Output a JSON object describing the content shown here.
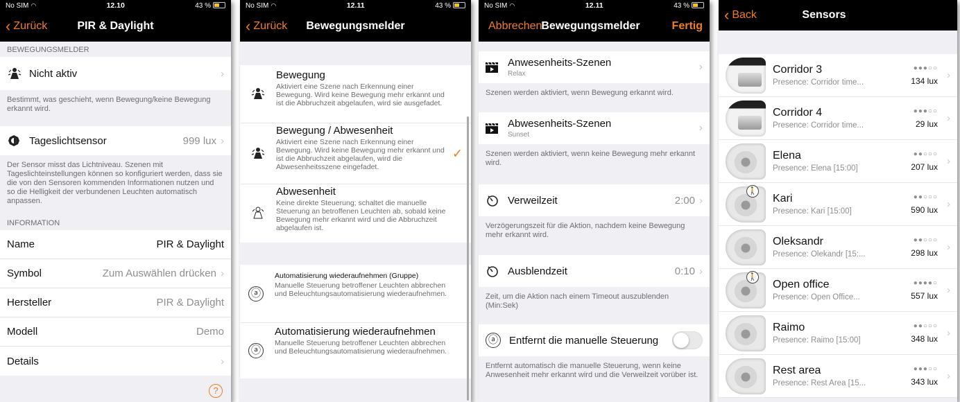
{
  "colors": {
    "accent": "#f07e1f",
    "navbar": "#000000",
    "background": "#efeff4"
  },
  "screen1": {
    "status": {
      "carrier": "No SIM",
      "time": "12.10",
      "battery": "43 %"
    },
    "nav": {
      "back": "Zurück",
      "title": "PIR & Daylight"
    },
    "section_motion": "BEWEGUNGSMELDER",
    "motion_cell": {
      "label": "Nicht aktiv",
      "icon": "people-icon"
    },
    "motion_footer": "Bestimmt, was geschieht, wenn Bewegung/keine Bewegung erkannt wird.",
    "daylight_cell": {
      "label": "Tageslichtsensor",
      "value": "999 lux",
      "icon": "brightness-icon"
    },
    "daylight_footer": "Der Sensor misst das Lichtniveau. Szenen mit Tageslichteinstellungen können so konfiguriert werden, dass sie die von den Sensoren kommenden Informationen nutzen und so die Helligkeit der verbundenen Leuchten automatisch anpassen.",
    "section_info": "INFORMATION",
    "info_rows": [
      {
        "label": "Name",
        "value": "PIR & Daylight"
      },
      {
        "label": "Symbol",
        "value": "Zum Auswählen drücken"
      },
      {
        "label": "Hersteller",
        "value": "PIR & Daylight"
      },
      {
        "label": "Modell",
        "value": "Demo"
      },
      {
        "label": "Details",
        "value": ""
      }
    ],
    "help": "?"
  },
  "screen2": {
    "status": {
      "carrier": "No SIM",
      "time": "12.11",
      "battery": "43 %"
    },
    "nav": {
      "back": "Zurück",
      "title": "Bewegungsmelder"
    },
    "options": [
      {
        "title": "Bewegung",
        "desc": "Aktiviert eine Szene nach Erkennung einer Bewegung. Wird keine Bewegung mehr erkannt und ist die Abbruchzeit abgelaufen, wird sie ausgefadet."
      },
      {
        "title": "Bewegung / Abwesenheit",
        "desc": "Aktiviert eine Szene nach Erkennung einer Bewegung. Wird keine Bewegung mehr erkannt und ist die Abbruchzeit abgelaufen, wird die Abwesenheitsszene eingefadet."
      },
      {
        "title": "Abwesenheit",
        "desc": "Keine direkte Steuerung; schaltet die manuelle Steuerung an betroffenen Leuchten ab, sobald keine Bewegung mehr erkannt wird und die Abbruchzeit abgelaufen ist."
      }
    ],
    "auto_options": [
      {
        "title": "Automatisierung wiederaufnehmen (Gruppe)",
        "desc": "Manuelle Steuerung betroffener Leuchten abbrechen und Beleuchtungsautomatisierung wiederaufnehmen."
      },
      {
        "title": "Automatisierung wiederaufnehmen",
        "desc": "Manuelle Steuerung betroffener Leuchten abbrechen und Beleuchtungsautomatisierung wiederaufnehmen."
      }
    ],
    "check": "✓",
    "circle_a": "ⓐ"
  },
  "screen3": {
    "status": {
      "carrier": "No SIM",
      "time": "12.11",
      "battery": "43 %"
    },
    "nav": {
      "cancel": "Abbrechen",
      "title": "Bewegungsmelder",
      "done": "Fertig"
    },
    "presence": {
      "title": "Anwesenheits-Szenen",
      "sub": "Relax"
    },
    "presence_footer": "Szenen werden aktiviert, wenn Bewegung erkannt wird.",
    "absence": {
      "title": "Abwesenheits-Szenen",
      "sub": "Sunset"
    },
    "absence_footer": "Szenen werden aktiviert, wenn keine Bewegung mehr erkannt wird.",
    "dwell": {
      "label": "Verweilzeit",
      "value": "2:00"
    },
    "dwell_footer": "Verzögerungszeit für die Aktion, nachdem keine Bewegung mehr erkannt wird.",
    "fade": {
      "label": "Ausblendzeit",
      "value": "0:10"
    },
    "fade_footer": "Zeit, um die Aktion nach einem Timeout auszublenden (Min:Sek)",
    "manual": {
      "label": "Entfernt die manuelle Steuerung"
    },
    "manual_footer": "Entfernt automatisch die manuelle Steuerung, wenn keine Anwesenheit mehr erkannt wird und die Verweilzeit vorüber ist."
  },
  "screen4": {
    "nav": {
      "back": "Back",
      "title": "Sensors"
    },
    "sensors": [
      {
        "name": "Corridor 3",
        "sub": "Presence: Corridor time...",
        "signal": "●●●○○",
        "lux": "134 lux",
        "thumb": "pipe",
        "walker": false
      },
      {
        "name": "Corridor 4",
        "sub": "Presence: Corridor time...",
        "signal": "●●●○○",
        "lux": "29 lux",
        "thumb": "pipe",
        "walker": false
      },
      {
        "name": "Elena",
        "sub": "Presence: Elena [15:00]",
        "signal": "●●○○○",
        "lux": "207 lux",
        "thumb": "dome",
        "walker": false
      },
      {
        "name": "Kari",
        "sub": "Presence: Kari [15:00]",
        "signal": "●●○○○",
        "lux": "590 lux",
        "thumb": "dome",
        "walker": true
      },
      {
        "name": "Oleksandr",
        "sub": "Presence: Olekandr [15:...",
        "signal": "●●○○○",
        "lux": "298 lux",
        "thumb": "dome",
        "walker": false
      },
      {
        "name": "Open office",
        "sub": "Presence: Open Office...",
        "signal": "●●●●○",
        "lux": "557 lux",
        "thumb": "dome",
        "walker": true
      },
      {
        "name": "Raimo",
        "sub": "Presence: Raimo [15:00]",
        "signal": "●●○○○",
        "lux": "348 lux",
        "thumb": "dome",
        "walker": false
      },
      {
        "name": "Rest area",
        "sub": "Presence: Rest Area [15...",
        "signal": "●●●○○",
        "lux": "343 lux",
        "thumb": "dome",
        "walker": false
      }
    ]
  }
}
